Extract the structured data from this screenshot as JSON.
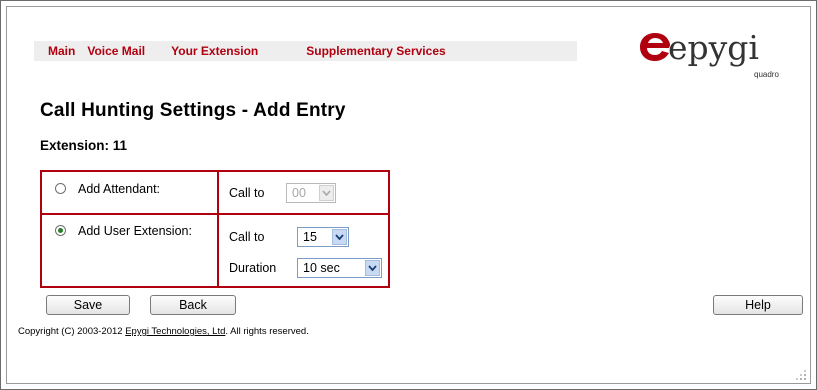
{
  "nav": {
    "items": [
      "Main",
      "Voice Mail",
      "Your Extension",
      "Supplementary Services"
    ]
  },
  "logo": {
    "text": "epygi",
    "subtext": "quadro",
    "color": "#b00010"
  },
  "page": {
    "title": "Call Hunting Settings - Add Entry",
    "extension_label": "Extension: 11"
  },
  "form": {
    "attendant": {
      "label": "Add Attendant:",
      "selected": false,
      "call_to_label": "Call to",
      "call_to_value": "00",
      "disabled": true
    },
    "user_extension": {
      "label": "Add User Extension:",
      "selected": true,
      "call_to_label": "Call to",
      "call_to_value": "15",
      "duration_label": "Duration",
      "duration_value": "10 sec"
    }
  },
  "buttons": {
    "save": "Save",
    "back": "Back",
    "help": "Help"
  },
  "footer": {
    "prefix": "Copyright (C) 2003-2012 ",
    "link": "Epygi Technologies, Ltd",
    "suffix": ". All rights reserved."
  },
  "colors": {
    "accent": "#b00010",
    "nav_bg": "#eeeeee"
  }
}
